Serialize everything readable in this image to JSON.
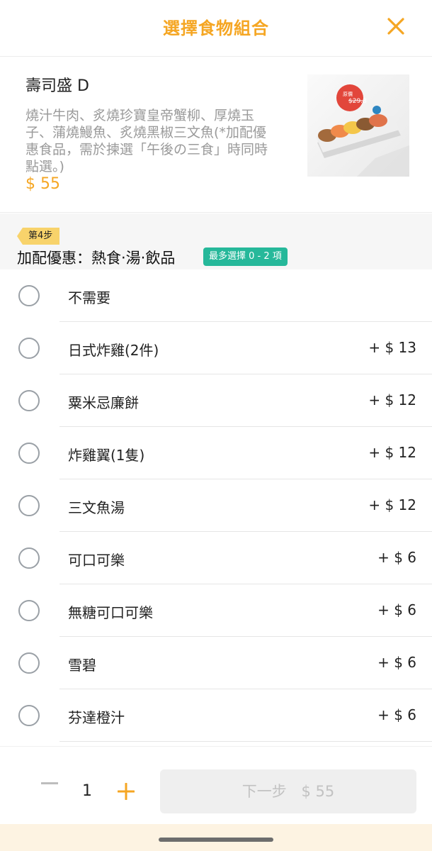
{
  "header": {
    "title": "選擇食物組合",
    "close_icon": "close-icon",
    "accent_color": "#f5a623"
  },
  "product": {
    "name": "壽司盛 D",
    "description": "燒汁牛肉、炙燒珍寶皇帝蟹柳、厚燒玉子、蒲燒鰻魚、炙燒黑椒三文魚(*加配優惠食品，需於揀選「午後の三食」時同時點選。)",
    "price": "$ 55",
    "image_badge_label": "原價",
    "image_original_price": "$29.8"
  },
  "step": {
    "badge": "第4步",
    "title": "加配優惠：熱食‧湯‧飲品",
    "limit": "最多選擇 0 - 2 項",
    "limit_color": "#26b89a"
  },
  "options": [
    {
      "label": "不需要",
      "price": ""
    },
    {
      "label": "日式炸雞(2件)",
      "price": "+ $ 13"
    },
    {
      "label": "粟米忌廉餅",
      "price": "+ $ 12"
    },
    {
      "label": "炸雞翼(1隻)",
      "price": "+ $ 12"
    },
    {
      "label": "三文魚湯",
      "price": "+ $ 12"
    },
    {
      "label": "可口可樂",
      "price": "+ $ 6"
    },
    {
      "label": "無糖可口可樂",
      "price": "+ $ 6"
    },
    {
      "label": "雪碧",
      "price": "+ $ 6"
    },
    {
      "label": "芬達橙汁",
      "price": "+ $ 6"
    }
  ],
  "footer": {
    "quantity": "1",
    "minus_icon": "minus-icon",
    "plus_icon": "plus-icon",
    "next_label": "下一步",
    "next_price": "$ 55"
  }
}
